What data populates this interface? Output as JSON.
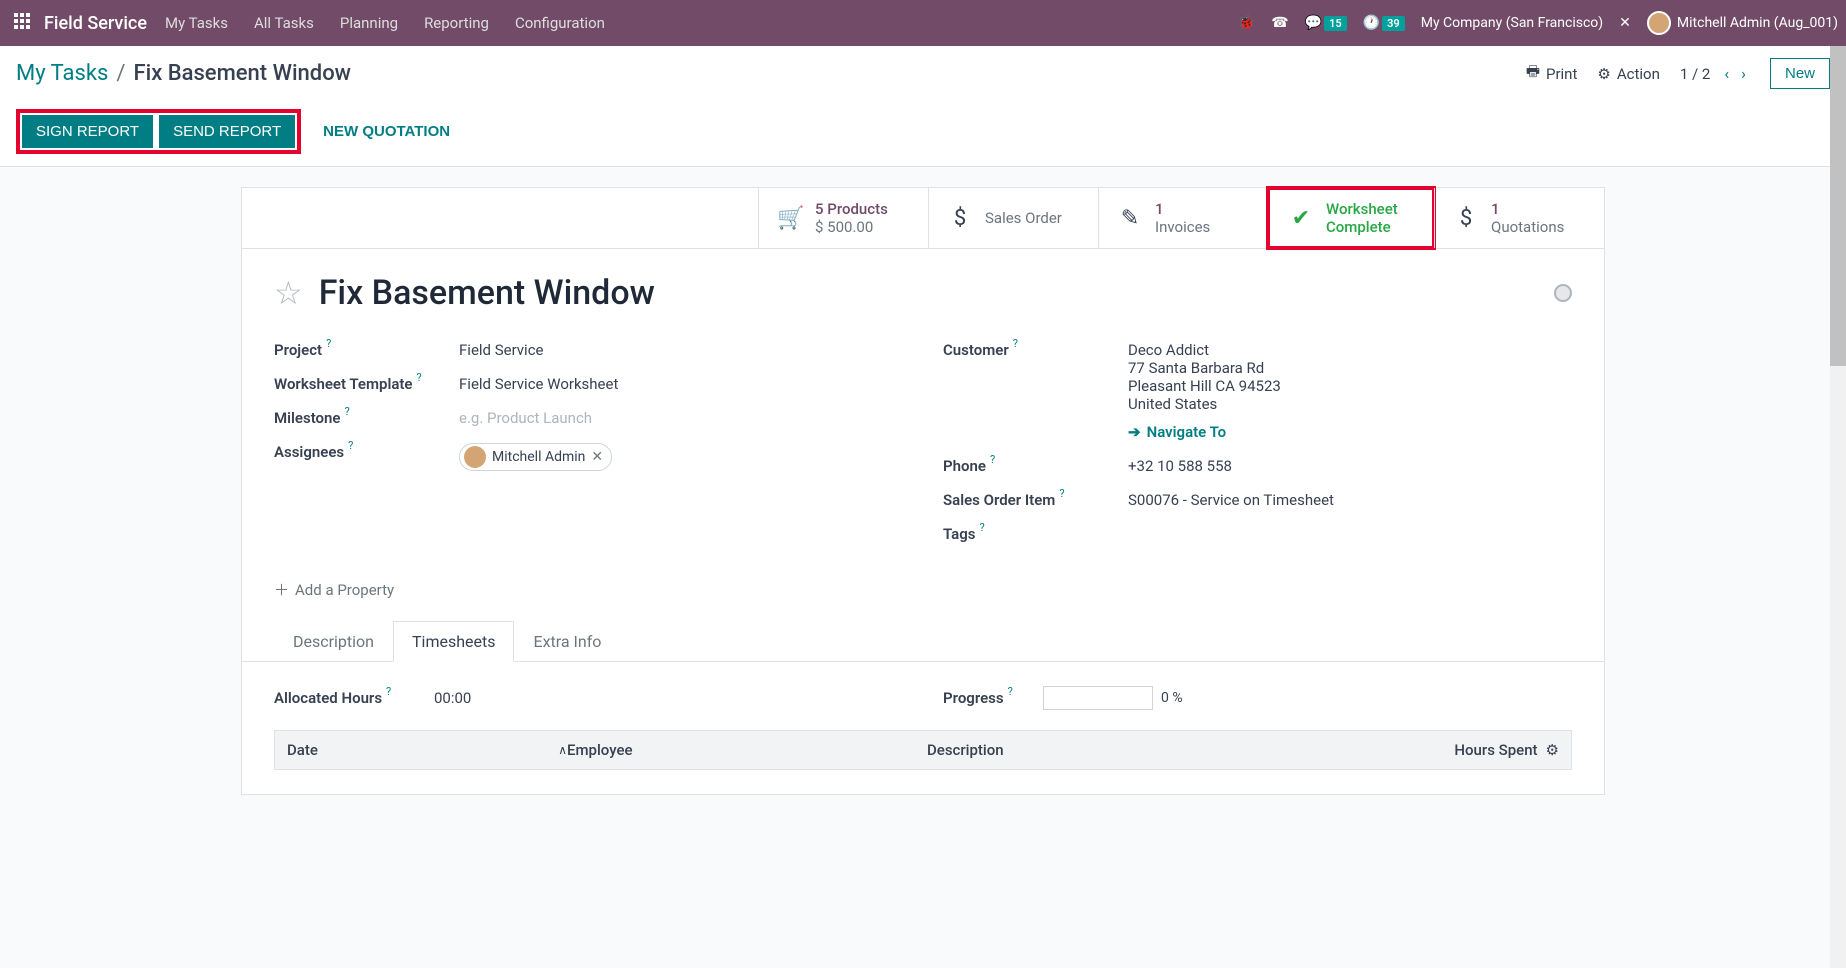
{
  "topnav": {
    "app_title": "Field Service",
    "menu": [
      "My Tasks",
      "All Tasks",
      "Planning",
      "Reporting",
      "Configuration"
    ],
    "messages_badge": "15",
    "activities_badge": "39",
    "company": "My Company (San Francisco)",
    "user": "Mitchell Admin (Aug_001)"
  },
  "breadcrumb": {
    "parent": "My Tasks",
    "current": "Fix Basement Window"
  },
  "control": {
    "print": "Print",
    "action": "Action",
    "pager": "1 / 2",
    "new_btn": "New"
  },
  "actions": {
    "sign_report": "SIGN REPORT",
    "send_report": "SEND REPORT",
    "new_quotation": "NEW QUOTATION"
  },
  "stats": {
    "products_l1": "5 Products",
    "products_l2": "$ 500.00",
    "sales_order": "Sales Order",
    "invoices_l1": "1",
    "invoices_l2": "Invoices",
    "worksheet_l1": "Worksheet",
    "worksheet_l2": "Complete",
    "quotations_l1": "1",
    "quotations_l2": "Quotations"
  },
  "task": {
    "title": "Fix Basement Window"
  },
  "fields": {
    "project_label": "Project",
    "project_value": "Field Service",
    "ws_template_label": "Worksheet Template",
    "ws_template_value": "Field Service Worksheet",
    "milestone_label": "Milestone",
    "milestone_placeholder": "e.g. Product Launch",
    "assignees_label": "Assignees",
    "assignee_chip": "Mitchell Admin",
    "customer_label": "Customer",
    "customer_name": "Deco Addict",
    "customer_addr1": "77 Santa Barbara Rd",
    "customer_addr2": "Pleasant Hill CA 94523",
    "customer_country": "United States",
    "navigate_to": "Navigate To",
    "phone_label": "Phone",
    "phone_value": "+32 10 588 558",
    "soi_label": "Sales Order Item",
    "soi_value": "S00076 - Service on Timesheet",
    "tags_label": "Tags",
    "add_property": "Add a Property"
  },
  "tabs": {
    "description": "Description",
    "timesheets": "Timesheets",
    "extra_info": "Extra Info"
  },
  "timesheets": {
    "allocated_label": "Allocated Hours",
    "allocated_value": "00:00",
    "progress_label": "Progress",
    "progress_value": "0 %",
    "th_date": "Date",
    "th_employee": "Employee",
    "th_description": "Description",
    "th_hours": "Hours Spent"
  }
}
